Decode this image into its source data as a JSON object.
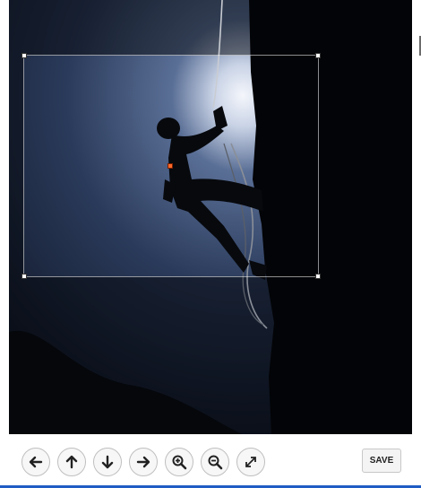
{
  "editor": {
    "image_description_icon": "image-preview"
  },
  "toolbar": {
    "buttons": [
      {
        "icon": "arrow-left-icon"
      },
      {
        "icon": "arrow-up-icon"
      },
      {
        "icon": "arrow-down-icon"
      },
      {
        "icon": "arrow-right-icon"
      },
      {
        "icon": "zoom-in-icon"
      },
      {
        "icon": "zoom-out-icon"
      },
      {
        "icon": "expand-icon"
      }
    ],
    "save_label": "SAVE"
  },
  "colors": {
    "crop_handle": "#ffffff",
    "center_handle": "#ff6a2a",
    "accent_bottom": "#1f5cc4"
  }
}
